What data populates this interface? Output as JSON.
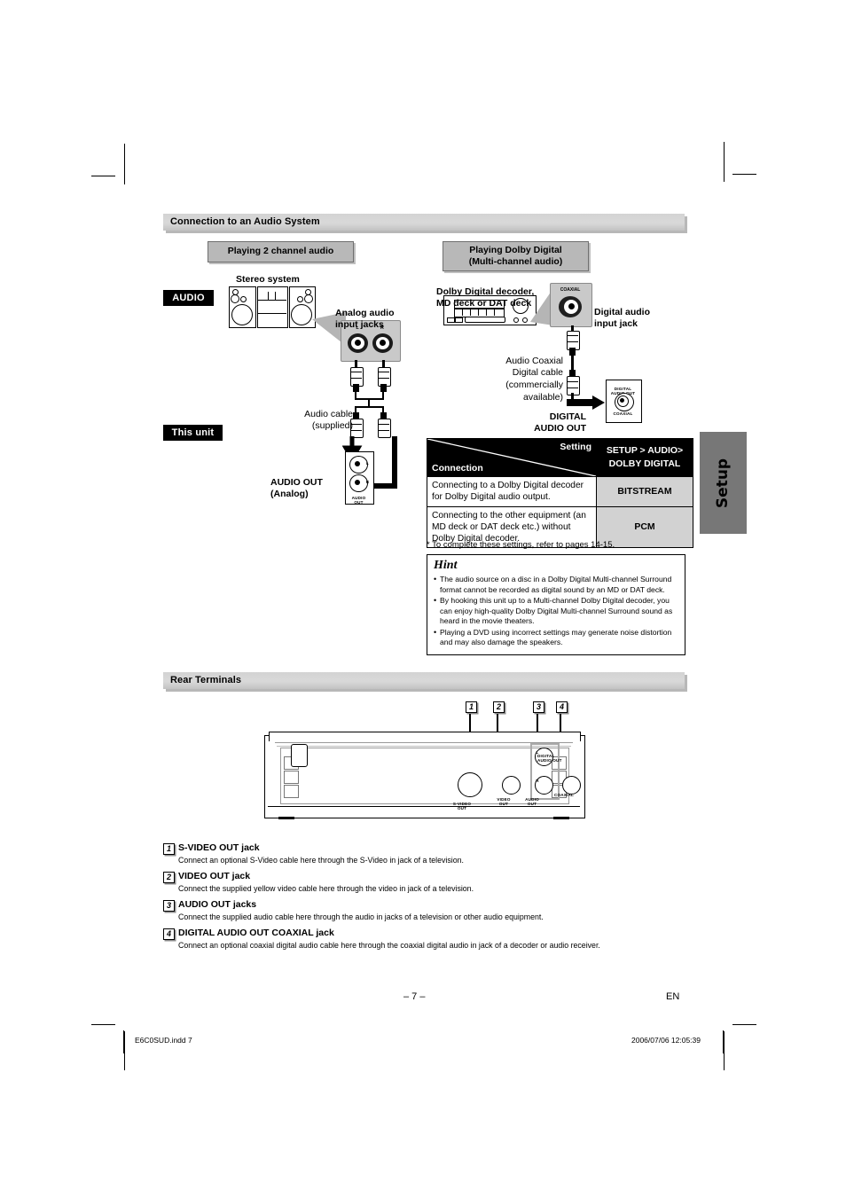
{
  "sections": {
    "audio_system": "Connection to an Audio System",
    "rear_terminals": "Rear Terminals"
  },
  "left_diagram": {
    "header": "Playing 2 channel audio",
    "device_label": "Stereo system",
    "tag_audio": "AUDIO",
    "tag_this_unit": "This unit",
    "jacks_label": "Analog audio\ninput jacks",
    "jack_l": "L",
    "jack_r": "R",
    "cable_label": "Audio cable\n(supplied)",
    "out_label": "AUDIO OUT\n(Analog)",
    "unit_jack_caption": "AUDIO\nOUT",
    "unit_jack_l": "L",
    "unit_jack_r": "R"
  },
  "right_diagram": {
    "header": "Playing Dolby Digital\n(Multi-channel audio)",
    "device_label": "Dolby Digital decoder,\nMD deck or DAT deck",
    "coaxial_tag": "COAXIAL",
    "input_jack_label": "Digital audio\ninput jack",
    "cable_label": "Audio Coaxial\nDigital cable\n(commercially\navailable)",
    "out_label": "DIGITAL\nAUDIO OUT",
    "unit_jack_caption_top": "DIGITAL\nAUDIO OUT",
    "unit_jack_caption_bottom": "COAXIAL"
  },
  "settings_table": {
    "corner_setting": "Setting",
    "corner_connection": "Connection",
    "header_right_line1": "SETUP > AUDIO>",
    "header_right_line2": "DOLBY DIGITAL",
    "rows": [
      {
        "connection": "Connecting to a Dolby Digital decoder for Dolby Digital audio output.",
        "value": "BITSTREAM"
      },
      {
        "connection": "Connecting to the other equipment (an MD deck or DAT deck etc.) without Dolby Digital decoder.",
        "value": "PCM"
      }
    ],
    "footnote": "* To complete these settings, refer to pages 14-15."
  },
  "hint": {
    "title": "Hint",
    "items": [
      "The audio source on a disc in a Dolby Digital Multi-channel Surround format cannot be recorded as digital sound by an MD or DAT deck.",
      "By hooking this unit up to a Multi-channel Dolby Digital decoder, you can enjoy high-quality Dolby Digital Multi-channel Surround sound as heard in the movie theaters.",
      "Playing a DVD using incorrect settings may generate noise distortion and may also damage the speakers."
    ]
  },
  "rear_panel": {
    "callouts": [
      "1",
      "2",
      "3",
      "4"
    ],
    "jack_labels": {
      "svideo": "S-VIDEO\nOUT",
      "video": "VIDEO\nOUT",
      "audio": "AUDIO\nOUT",
      "audio_l": "L",
      "audio_r": "R",
      "coaxial": "COAXIAL",
      "digital": "DIGITAL\nAUDIO OUT"
    }
  },
  "terminal_list": [
    {
      "num": "1",
      "title": "S-VIDEO OUT jack",
      "desc": "Connect an optional S-Video cable here through the S-Video in jack of a television."
    },
    {
      "num": "2",
      "title": "VIDEO OUT jack",
      "desc": "Connect the supplied yellow video cable here through the video in jack of a television."
    },
    {
      "num": "3",
      "title": "AUDIO OUT jacks",
      "desc": "Connect the supplied audio cable here through the audio in jacks of a television or other audio equipment."
    },
    {
      "num": "4",
      "title": "DIGITAL AUDIO OUT COAXIAL jack",
      "desc": "Connect an optional coaxial digital audio cable here through the coaxial digital audio in jack of a decoder or audio receiver."
    }
  ],
  "side_tab": {
    "label": "Setup"
  },
  "footer": {
    "page_number": "– 7 –",
    "language": "EN",
    "filename": "E6C0SUD.indd   7",
    "timestamp": "2006/07/06   12:05:39"
  }
}
